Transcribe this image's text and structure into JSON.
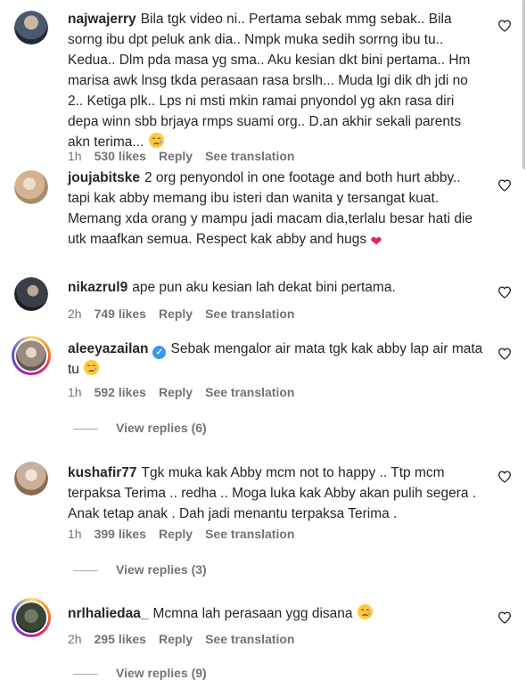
{
  "comments": [
    {
      "username": "najwajerry",
      "text": "Bila tgk video ni.. Pertama sebak mmg sebak.. Bila sorng ibu dpt peluk ank dia.. Nmpk muka sedih sorrng ibu tu.. Kedua.. Dlm pda masa yg sma.. Aku kesian dkt bini pertama.. Hm marisa awk lnsg tkda perasaan rasa brslh... Muda lgi dik dh jdi no 2.. Ketiga plk.. Lps ni msti mkin ramai pnyondol yg akn rasa diri depa winn sbb brjaya rmps suami org.. D.an akhir sekali parents akn terima...",
      "time": "1h",
      "likes": "530 likes",
      "reply": "Reply",
      "translation": "See translation"
    },
    {
      "username": "joujabitske",
      "text": "2 org penyondol in one footage and both hurt abby.. tapi kak abby memang ibu isteri dan wanita y tersangat kuat. Memang xda orang y mampu jadi macam dia,terlalu besar hati die utk maafkan semua. Respect kak abby and hugs"
    },
    {
      "username": "nikazrul9",
      "text": "ape pun aku kesian lah dekat bini pertama.",
      "time": "2h",
      "likes": "749 likes",
      "reply": "Reply",
      "translation": "See translation"
    },
    {
      "username": "aleeyazailan",
      "text": "Sebak mengalor air mata tgk kak abby lap air mata tu",
      "time": "1h",
      "likes": "592 likes",
      "reply": "Reply",
      "translation": "See translation",
      "view_replies": "View replies (6)"
    },
    {
      "username": "kushafir77",
      "text": "Tgk muka kak Abby mcm not to happy .. Ttp mcm terpaksa Terima .. redha .. Moga luka kak Abby akan pulih segera . Anak tetap anak . Dah jadi menantu terpaksa Terima .",
      "time": "1h",
      "likes": "399 likes",
      "reply": "Reply",
      "translation": "See translation",
      "view_replies": "View replies (3)"
    },
    {
      "username": "nrlhaliedaa_",
      "text": "Mcmna lah perasaan ygg disana",
      "time": "2h",
      "likes": "295 likes",
      "reply": "Reply",
      "translation": "See translation",
      "view_replies": "View replies (9)"
    }
  ],
  "icons": {
    "like": "heart-outline-icon",
    "emoji_sad": "crying-face-emoji",
    "emoji_heart": "red-heart-emoji",
    "verified": "verified-badge-icon"
  },
  "colors": {
    "text": "#262626",
    "meta": "#737373",
    "verified": "#3897f0"
  }
}
